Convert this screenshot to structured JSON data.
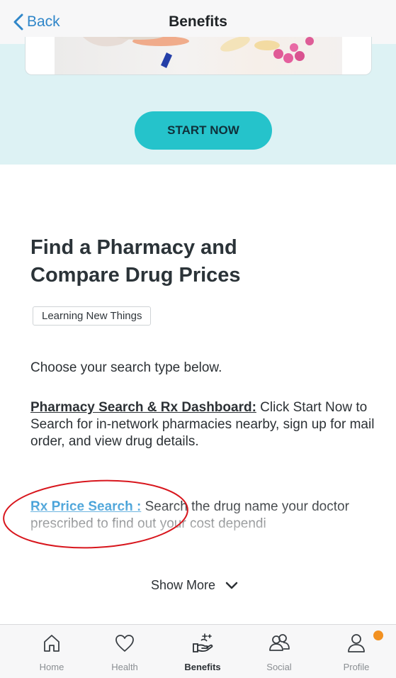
{
  "nav": {
    "back_label": "Back",
    "title": "Benefits"
  },
  "banner": {
    "start_label": "START NOW",
    "accent_color": "#25c3cb"
  },
  "card": {
    "headline": "Find a Pharmacy and Compare Drug Prices",
    "tag": "Learning New Things",
    "intro": "Choose your search type below.",
    "pharmacy_link": "Pharmacy Search & Rx Dashboard:",
    "pharmacy_text": " Click Start Now to Search for in-network pharmacies nearby, sign up for mail order, and view drug details.",
    "rx_link": "Rx Price Search :",
    "rx_text": " Search the drug name your doctor prescribed to find out your cost dependi",
    "show_more": "Show More"
  },
  "tabs": [
    {
      "label": "Home",
      "icon": "home-icon",
      "active": false
    },
    {
      "label": "Health",
      "icon": "heart-icon",
      "active": false
    },
    {
      "label": "Benefits",
      "icon": "hand-sparkle-icon",
      "active": true
    },
    {
      "label": "Social",
      "icon": "people-icon",
      "active": false
    },
    {
      "label": "Profile",
      "icon": "person-icon",
      "active": false,
      "badge_color": "#f29121"
    }
  ]
}
